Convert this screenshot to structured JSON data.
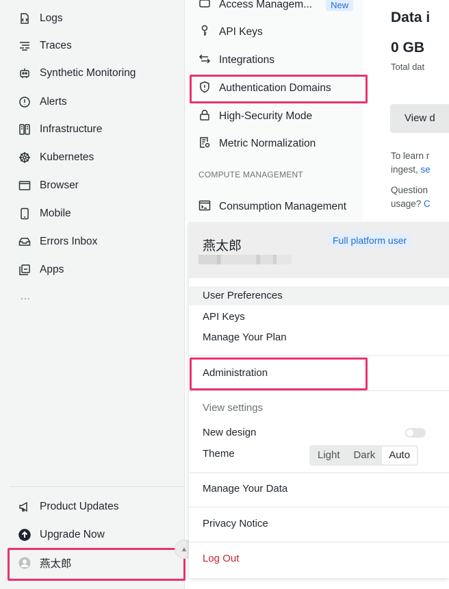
{
  "nav": {
    "items": [
      {
        "label": "Logs",
        "icon": "logs-icon"
      },
      {
        "label": "Traces",
        "icon": "traces-icon"
      },
      {
        "label": "Synthetic Monitoring",
        "icon": "robot-icon"
      },
      {
        "label": "Alerts",
        "icon": "alert-icon"
      },
      {
        "label": "Infrastructure",
        "icon": "infrastructure-icon"
      },
      {
        "label": "Kubernetes",
        "icon": "kubernetes-icon"
      },
      {
        "label": "Browser",
        "icon": "browser-icon"
      },
      {
        "label": "Mobile",
        "icon": "mobile-icon"
      },
      {
        "label": "Errors Inbox",
        "icon": "inbox-icon"
      },
      {
        "label": "Apps",
        "icon": "apps-icon"
      }
    ],
    "more": "...",
    "bottom": [
      {
        "label": "Product Updates",
        "icon": "megaphone-icon"
      },
      {
        "label": "Upgrade Now",
        "icon": "upgrade-icon"
      },
      {
        "label": "燕太郎",
        "icon": "user-avatar-icon"
      }
    ]
  },
  "submenu": {
    "items": [
      {
        "label": "Access Managem...",
        "badge": "New",
        "icon": "access-icon"
      },
      {
        "label": "API Keys",
        "icon": "key-icon"
      },
      {
        "label": "Integrations",
        "icon": "integrations-icon"
      },
      {
        "label": "Authentication Domains",
        "icon": "shield-icon"
      },
      {
        "label": "High-Security Mode",
        "icon": "lock-icon"
      },
      {
        "label": "Metric Normalization",
        "icon": "metric-icon"
      }
    ],
    "section_compute": "COMPUTE MANAGEMENT",
    "compute_items": [
      {
        "label": "Consumption Management",
        "icon": "terminal-icon"
      }
    ]
  },
  "content": {
    "title": "Data i",
    "value": "0 GB",
    "total": "Total dat",
    "view_button": "View d",
    "learn_line1": "To learn r",
    "learn_line2_text": "ingest, ",
    "learn_line2_link": "se",
    "question_line1": "Question",
    "question_line2_text": "usage? ",
    "question_line2_link": "C"
  },
  "menu": {
    "username": "燕太郎",
    "badge": "Full platform user",
    "user_preferences": "User Preferences",
    "api_keys": "API Keys",
    "manage_plan": "Manage Your Plan",
    "administration": "Administration",
    "view_settings": "View settings",
    "new_design": "New design",
    "new_design_enabled": false,
    "theme": "Theme",
    "theme_options": [
      "Light",
      "Dark",
      "Auto"
    ],
    "theme_selected": "Auto",
    "manage_data": "Manage Your Data",
    "privacy": "Privacy Notice",
    "logout": "Log Out"
  },
  "colors": {
    "highlight": "#e8336d",
    "link": "#1f6fd0",
    "logout": "#c4272c"
  }
}
